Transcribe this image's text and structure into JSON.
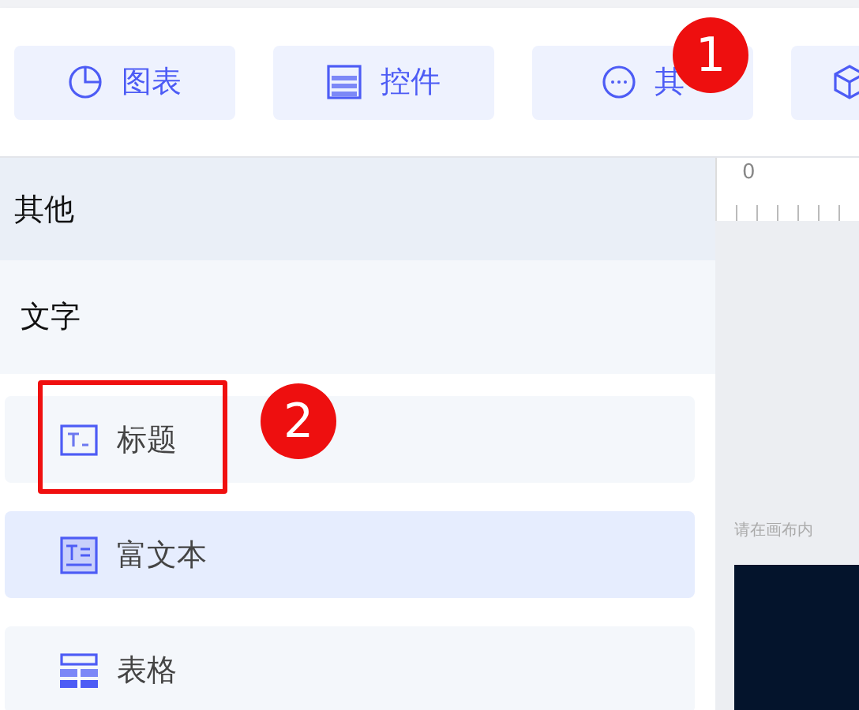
{
  "toolbar": [
    {
      "label": "图表",
      "cut_off": false
    },
    {
      "label": "控件",
      "cut_off": false
    },
    {
      "label": "其",
      "cut_off": false
    },
    {
      "cut_off": true
    }
  ],
  "panel": {
    "title": "其他",
    "group": "文字",
    "items": [
      {
        "label": "标题",
        "highlighted": false
      },
      {
        "label": "富文本",
        "highlighted": true
      },
      {
        "label": "表格",
        "highlighted": false
      }
    ]
  },
  "canvas": {
    "ruler_start": "0",
    "hint": "请在画布内"
  },
  "annotations": [
    {
      "label": "1"
    },
    {
      "label": "2"
    }
  ]
}
